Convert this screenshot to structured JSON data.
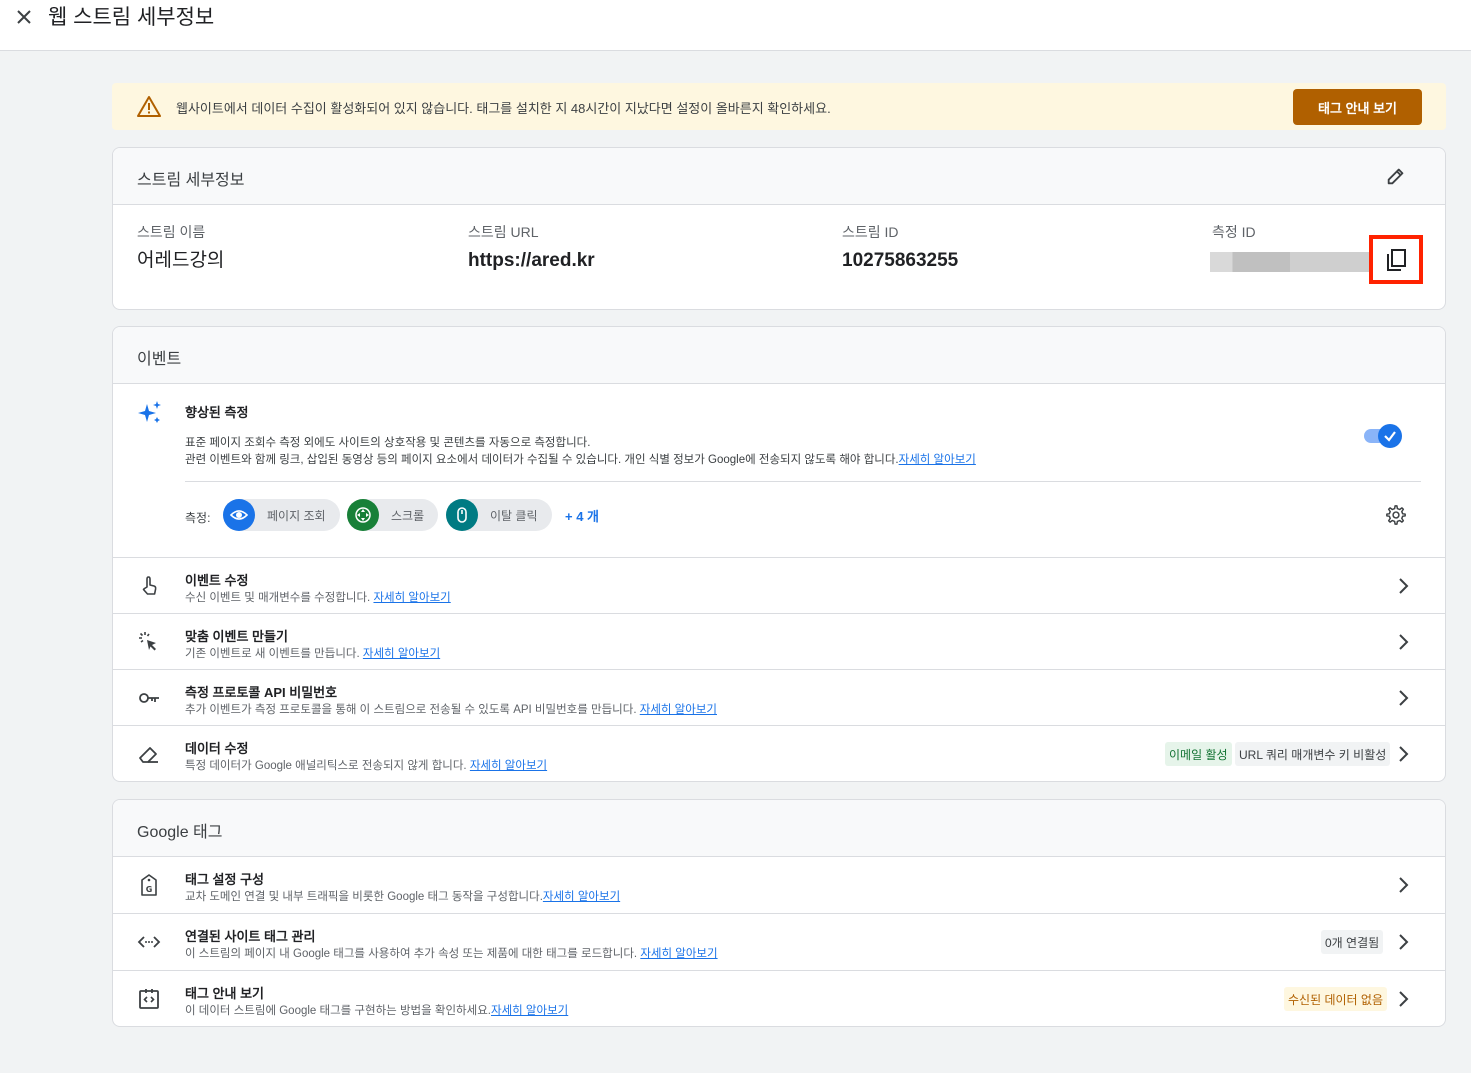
{
  "header": {
    "title": "웹 스트림 세부정보"
  },
  "banner": {
    "message": "웹사이트에서 데이터 수집이 활성화되어 있지 않습니다. 태그를 설치한 지 48시간이 지났다면 설정이 올바른지 확인하세요.",
    "button": "태그 안내 보기"
  },
  "stream": {
    "title": "스트림 세부정보",
    "fields": [
      {
        "label": "스트림 이름",
        "value": "어레드강의"
      },
      {
        "label": "스트림 URL",
        "value": "https://ared.kr"
      },
      {
        "label": "스트림 ID",
        "value": "10275863255"
      },
      {
        "label": "측정 ID",
        "value": ""
      }
    ]
  },
  "events": {
    "title": "이벤트",
    "enhanced": {
      "title": "향상된 측정",
      "desc1": "표준 페이지 조회수 측정 외에도 사이트의 상호작용 및 콘텐츠를 자동으로 측정합니다.",
      "desc2": "관련 이벤트와 함께 링크, 삽입된 동영상 등의 페이지 요소에서 데이터가 수집될 수 있습니다. 개인 식별 정보가 Google에 전송되지 않도록 해야 합니다.",
      "learn_more": "자세히 알아보기",
      "enabled": true,
      "measure_label": "측정:",
      "chips": [
        "페이지 조회",
        "스크롤",
        "이탈 클릭"
      ],
      "more": "+ 4 개"
    },
    "rows": [
      {
        "title": "이벤트 수정",
        "desc": "수신 이벤트 및 매개변수를 수정합니다.",
        "link": "자세히 알아보기"
      },
      {
        "title": "맞춤 이벤트 만들기",
        "desc": "기존 이벤트로 새 이벤트를 만듭니다.",
        "link": "자세히 알아보기"
      },
      {
        "title": "측정 프로토콜 API 비밀번호",
        "desc": "추가 이벤트가 측정 프로토콜을 통해 이 스트림으로 전송될 수 있도록 API 비밀번호를 만듭니다.",
        "link": "자세히 알아보기"
      },
      {
        "title": "데이터 수정",
        "desc": "특정 데이터가 Google 애널리틱스로 전송되지 않게 합니다.",
        "link": "자세히 알아보기",
        "badges": [
          "이메일 활성",
          "URL 쿼리 매개변수 키 비활성"
        ]
      }
    ]
  },
  "google_tag": {
    "title": "Google 태그",
    "rows": [
      {
        "title": "태그 설정 구성",
        "desc": "교차 도메인 연결 및 내부 트래픽을 비롯한 Google 태그 동작을 구성합니다.",
        "link": "자세히 알아보기"
      },
      {
        "title": "연결된 사이트 태그 관리",
        "desc": "이 스트림의 페이지 내 Google 태그를 사용하여 추가 속성 또는 제품에 대한 태그를 로드합니다.",
        "link": "자세히 알아보기",
        "badge": "0개 연결됨"
      },
      {
        "title": "태그 안내 보기",
        "desc": "이 데이터 스트림에 Google 태그를 구현하는 방법을 확인하세요.",
        "link": "자세히 알아보기",
        "badge": "수신된 데이터 없음"
      }
    ]
  },
  "colors": {
    "accent": "#1a73e8",
    "warning_bg": "#fef7e0",
    "warning_button": "#b06000",
    "highlight_border": "#ff2200",
    "chip_pageview": "#1a73e8",
    "chip_scroll": "#188038",
    "chip_outbound": "#007b83"
  }
}
